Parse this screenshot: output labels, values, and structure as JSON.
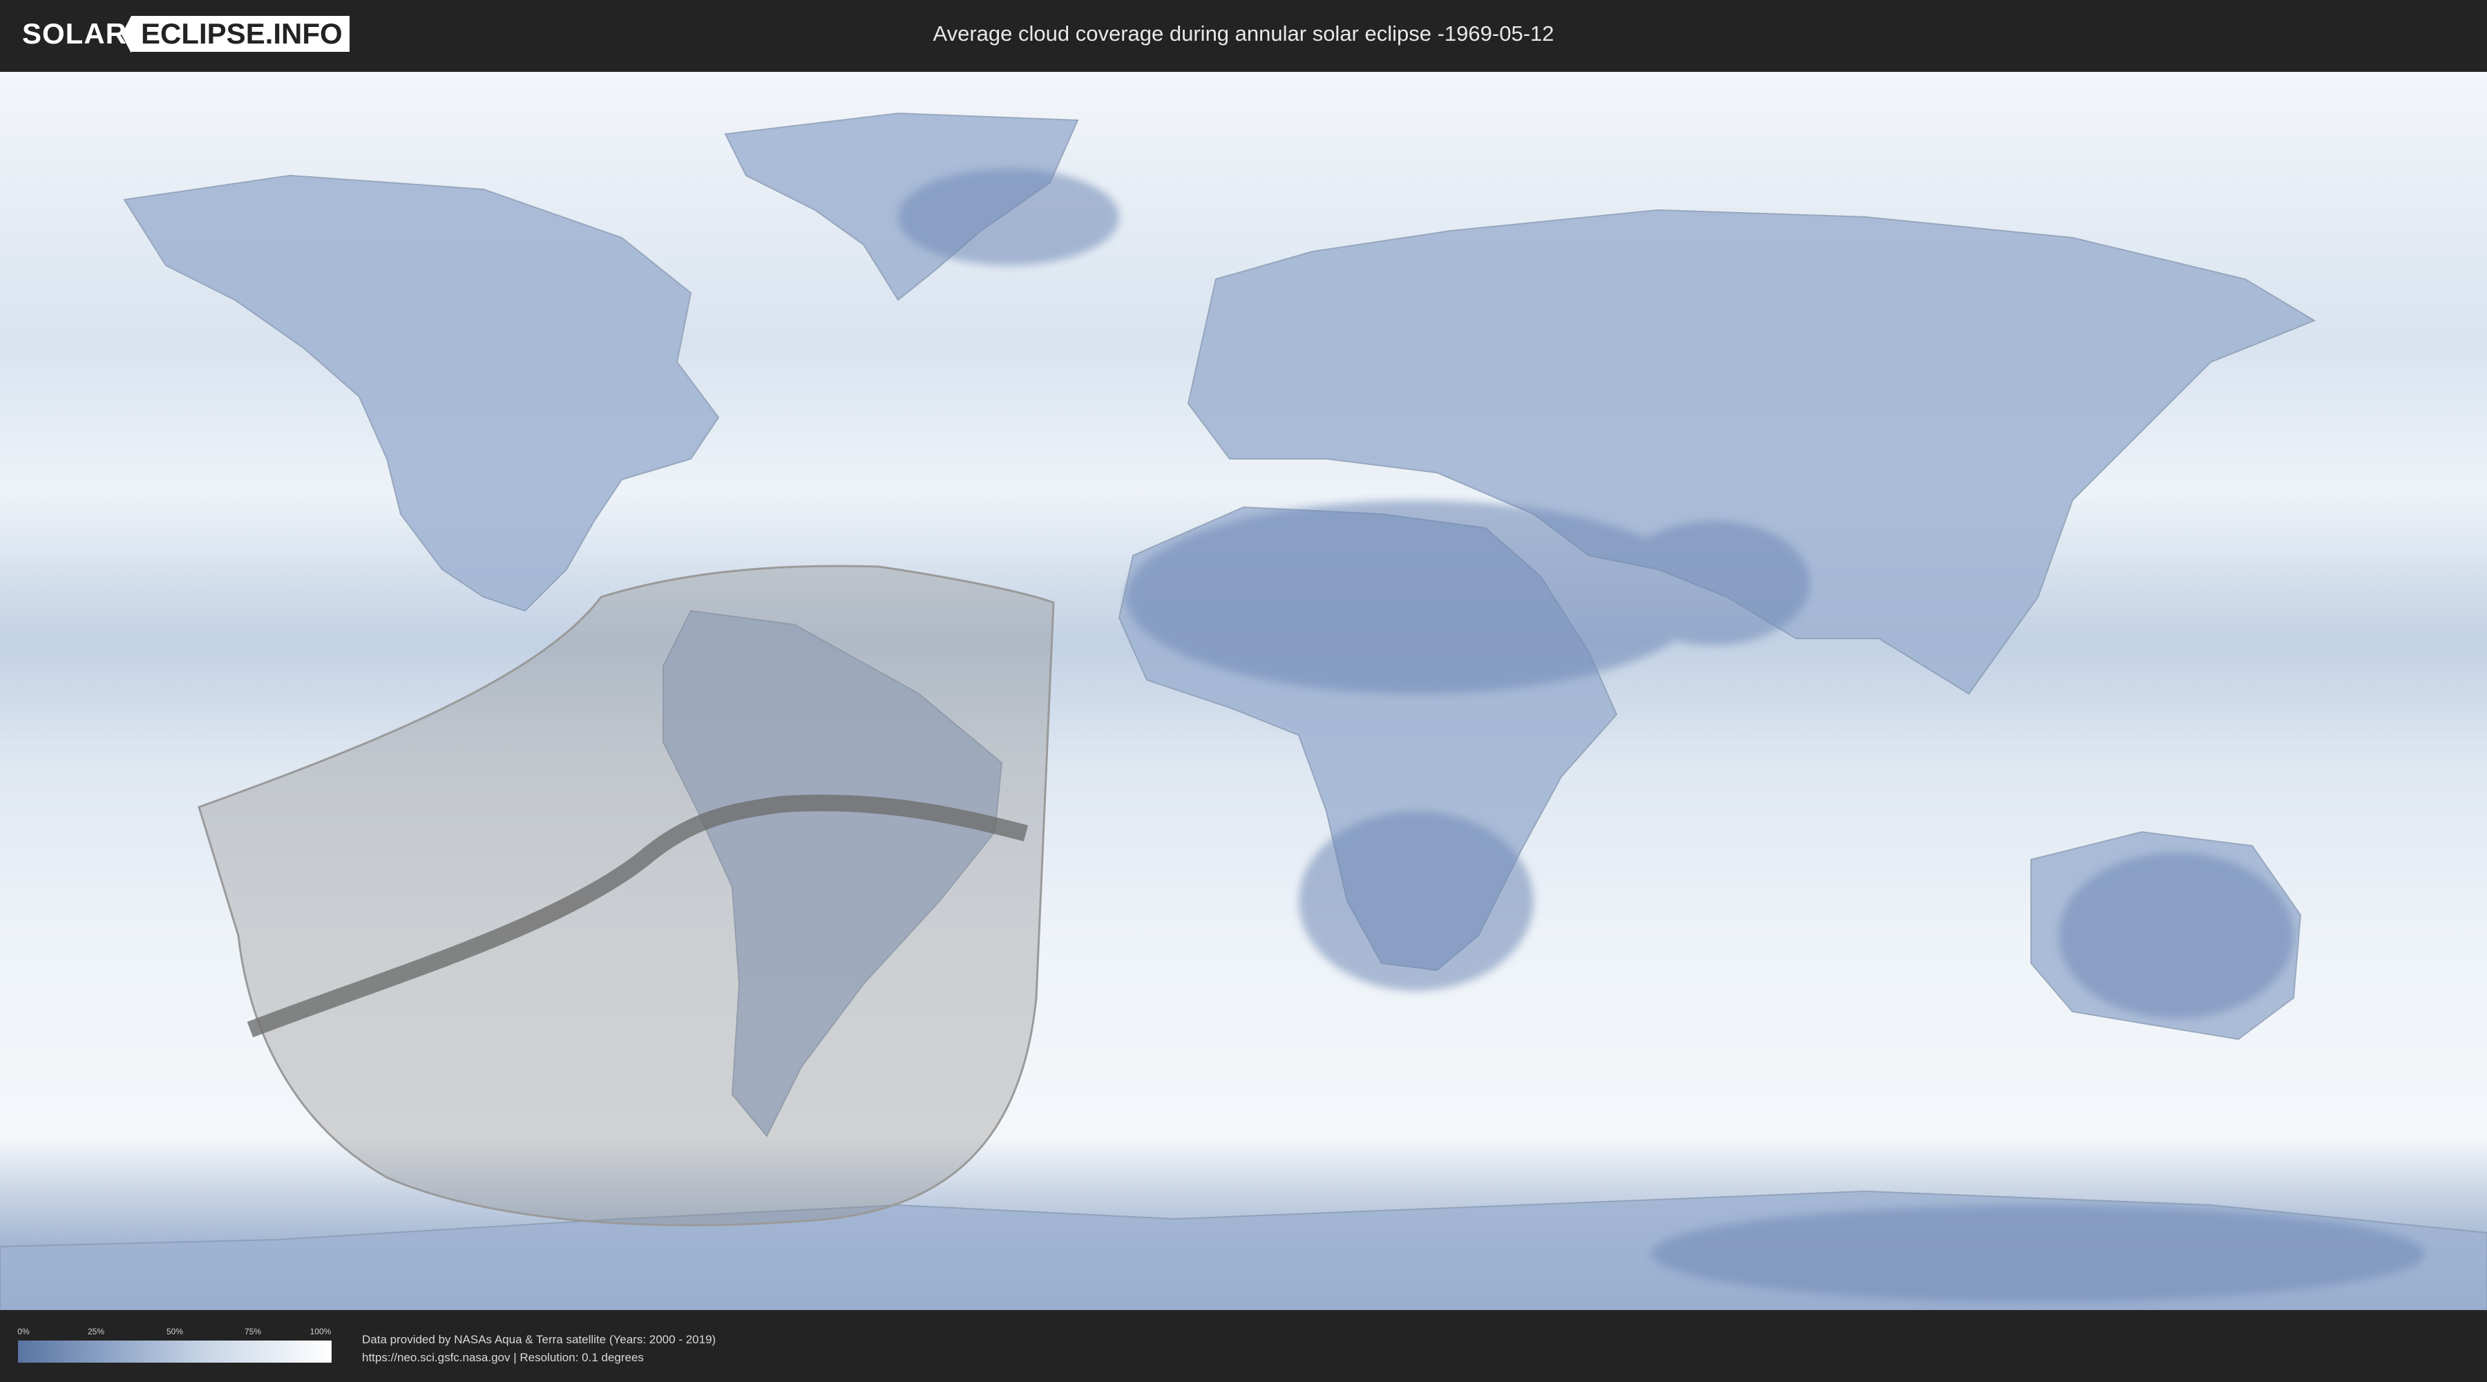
{
  "header": {
    "logo_left": "SOLAR",
    "logo_right": "ECLIPSE.INFO",
    "title": "Average cloud coverage during annular solar eclipse -1969-05-12"
  },
  "legend": {
    "ticks": [
      "0%",
      "25%",
      "50%",
      "75%",
      "100%"
    ],
    "tick_values": [
      0,
      25,
      50,
      75,
      100
    ],
    "color_low": "#5a74a2",
    "color_high": "#ffffff"
  },
  "footer": {
    "line1": "Data provided by NASAs Aqua & Terra satellite (Years: 2000 - 2019)",
    "line2": "https://neo.sci.gsfc.nasa.gov | Resolution: 0.1 degrees"
  },
  "colors": {
    "background": "#232323",
    "map_cloud": "#eef3f9",
    "map_clear": "#6b86b3",
    "eclipse_zone": "#8c8c8c",
    "eclipse_path": "#6e6e6e"
  }
}
